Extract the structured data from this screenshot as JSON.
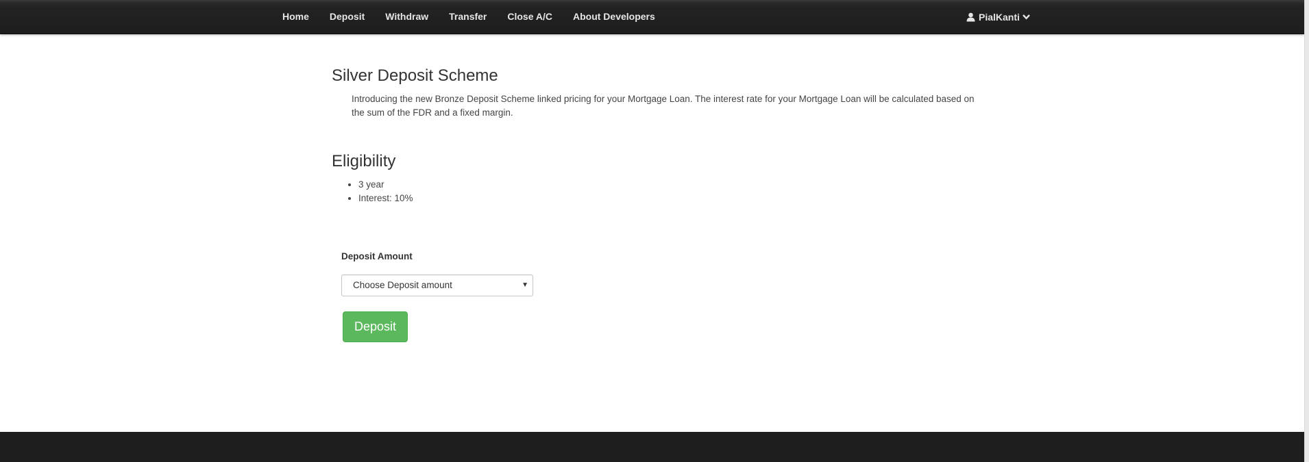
{
  "navbar": {
    "items": [
      {
        "label": "Home"
      },
      {
        "label": "Deposit"
      },
      {
        "label": "Withdraw"
      },
      {
        "label": "Transfer"
      },
      {
        "label": "Close A/C"
      },
      {
        "label": "About Developers"
      }
    ],
    "user": {
      "name": "PialKanti",
      "icon": "user-icon",
      "dropdown_icon": "chevron-down-icon"
    }
  },
  "scheme": {
    "title": "Silver Deposit Scheme",
    "description": "Introducing the new Bronze Deposit Scheme linked pricing for your Mortgage Loan. The interest rate for your Mortgage Loan will be calculated based on the sum of the FDR and a fixed margin."
  },
  "eligibility": {
    "title": "Eligibility",
    "items": [
      "3 year",
      "Interest: 10%"
    ]
  },
  "form": {
    "amount_label": "Deposit Amount",
    "amount_selected": "Choose Deposit amount",
    "submit_label": "Deposit"
  },
  "colors": {
    "navbar_bg": "#222222",
    "success_button": "#5cb85c",
    "footer_bg": "#1e1e1e"
  }
}
